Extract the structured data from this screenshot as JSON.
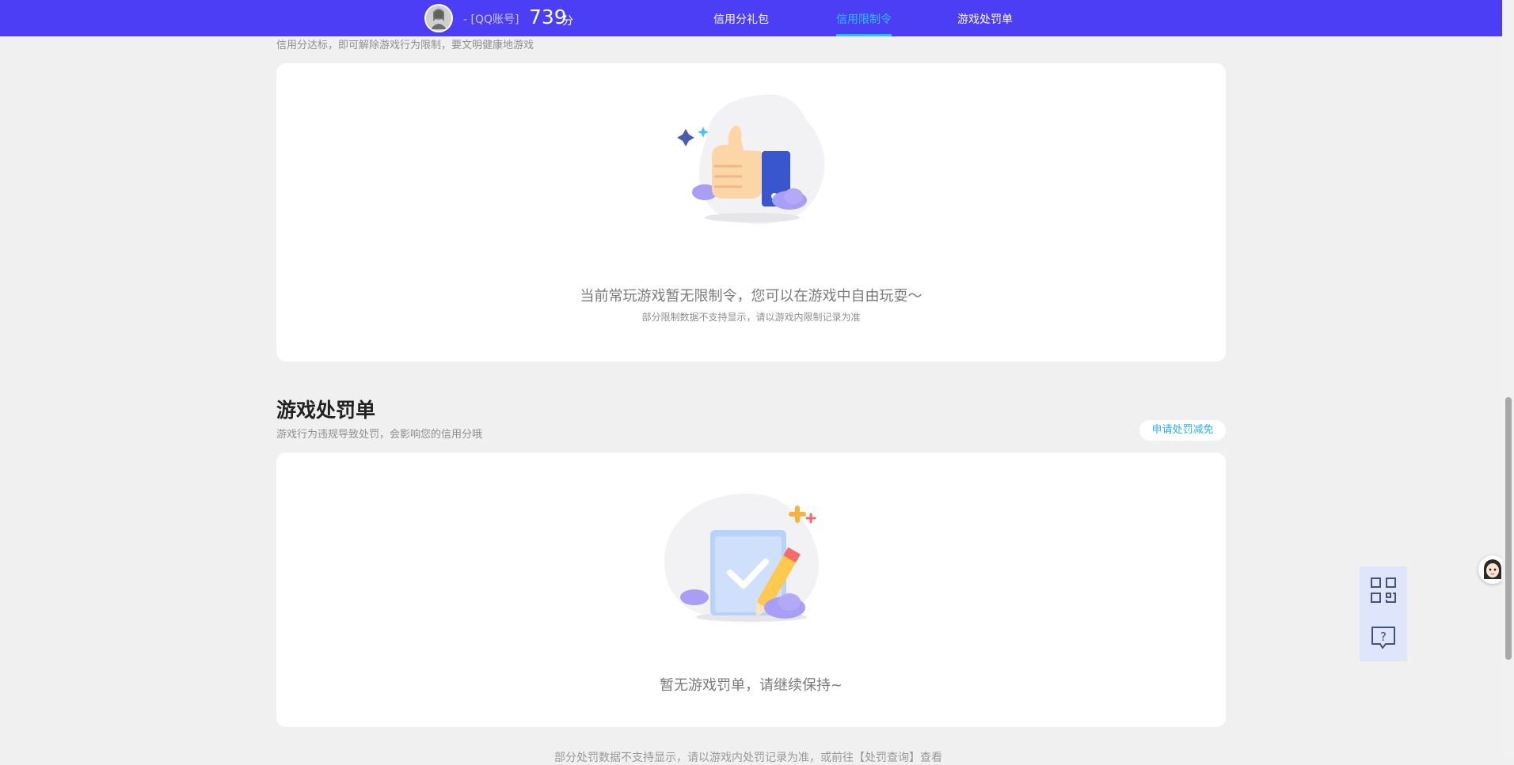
{
  "header": {
    "account_label": "- [QQ账号]",
    "score": "739",
    "score_unit": "分",
    "nav": [
      {
        "label": "信用分礼包"
      },
      {
        "label": "信用限制令"
      },
      {
        "label": "游戏处罚单"
      }
    ],
    "active_color": "#29c1ff",
    "brand_color": "#4b3ef5"
  },
  "restriction": {
    "subtitle": "信用分达标，即可解除游戏行为限制，要文明健康地游戏",
    "empty_main": "当前常玩游戏暂无限制令，您可以在游戏中自由玩耍～",
    "empty_note": "部分限制数据不支持显示，请以游戏内限制记录为准",
    "illustration_icon": "thumbs-up-icon"
  },
  "penalty": {
    "title": "游戏处罚单",
    "subtitle": "游戏行为违规导致处罚，会影响您的信用分哦",
    "appeal_label": "申请处罚减免",
    "empty_main": "暂无游戏罚单，请继续保持~",
    "illustration_icon": "clipboard-check-icon"
  },
  "footer": {
    "text": "部分处罚数据不支持显示，请以游戏内处罚记录为准，或前往【处罚查询】查看"
  },
  "side_tools": {
    "qr_icon": "qr-code-icon",
    "help_icon": "help-chat-icon"
  }
}
